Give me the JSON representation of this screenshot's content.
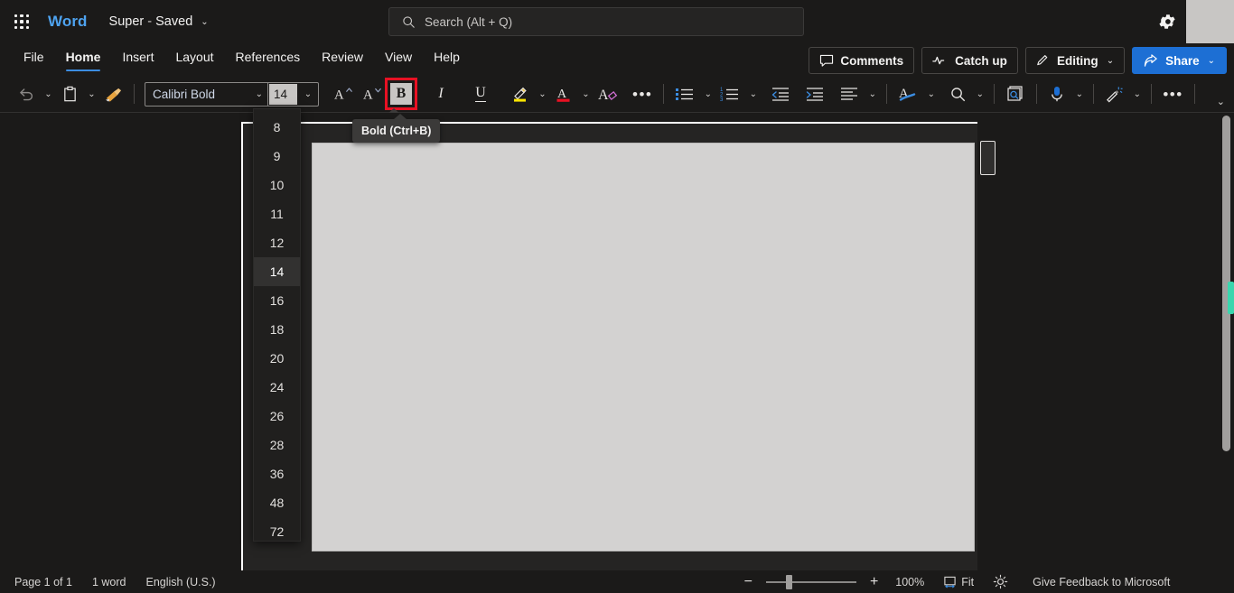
{
  "titlebar": {
    "app_launcher": "app-launcher",
    "brand": "Word",
    "doc_name": "Super",
    "doc_dash": "-",
    "doc_saved": "Saved",
    "chevron": "⌄",
    "settings_icon": "gear-icon"
  },
  "search": {
    "placeholder": "Search (Alt + Q)",
    "value": "",
    "icon": "search-icon"
  },
  "ribbon": {
    "tabs": [
      {
        "label": "File",
        "active": false
      },
      {
        "label": "Home",
        "active": true
      },
      {
        "label": "Insert",
        "active": false
      },
      {
        "label": "Layout",
        "active": false
      },
      {
        "label": "References",
        "active": false
      },
      {
        "label": "Review",
        "active": false
      },
      {
        "label": "View",
        "active": false
      },
      {
        "label": "Help",
        "active": false
      }
    ],
    "actions": {
      "comments": "Comments",
      "catch_up": "Catch up",
      "editing": "Editing",
      "share": "Share",
      "chevron": "⌄"
    },
    "collapse_chevron": "⌄"
  },
  "toolbar": {
    "undo": "undo-icon",
    "paste": "paste-icon",
    "format_painter": "format-painter-icon",
    "font_name": "Calibri Bold",
    "font_size": "14",
    "grow_font": "A",
    "shrink_font": "A",
    "bold": "B",
    "italic": "I",
    "underline": "U",
    "highlight": "text-highlight-icon",
    "font_color": "font-color-icon",
    "clear_format": "clear-formatting-icon",
    "more_font": "•••",
    "bullets": "bullet-list-icon",
    "numbering": "numbered-list-icon",
    "decrease_indent": "decrease-indent-icon",
    "increase_indent": "increase-indent-icon",
    "align": "align-icon",
    "styles": "styles-icon",
    "find": "find-icon",
    "editor": "editor-icon",
    "dictate": "dictate-icon",
    "designer": "designer-icon",
    "more": "•••",
    "chevron": "⌄"
  },
  "font_size_dropdown": {
    "open": true,
    "selected": "14",
    "options": [
      "8",
      "9",
      "10",
      "11",
      "12",
      "14",
      "16",
      "18",
      "20",
      "24",
      "26",
      "28",
      "36",
      "48",
      "72"
    ]
  },
  "tooltip": {
    "text": "Bold (Ctrl+B)"
  },
  "status": {
    "page": "Page 1 of 1",
    "words": "1 word",
    "language": "English (U.S.)",
    "zoom_minus": "−",
    "zoom_plus": "+",
    "zoom_level": "100%",
    "fit": "Fit",
    "focus_icon": "focus-mode-icon",
    "feedback": "Give Feedback to Microsoft"
  },
  "colors": {
    "accent_blue": "#1d6fd4",
    "brand_blue": "#4ea3f0",
    "highlight_red": "#e81123",
    "page_grey": "#d3d2d1",
    "scroll_marker": "#3ad6ad"
  }
}
